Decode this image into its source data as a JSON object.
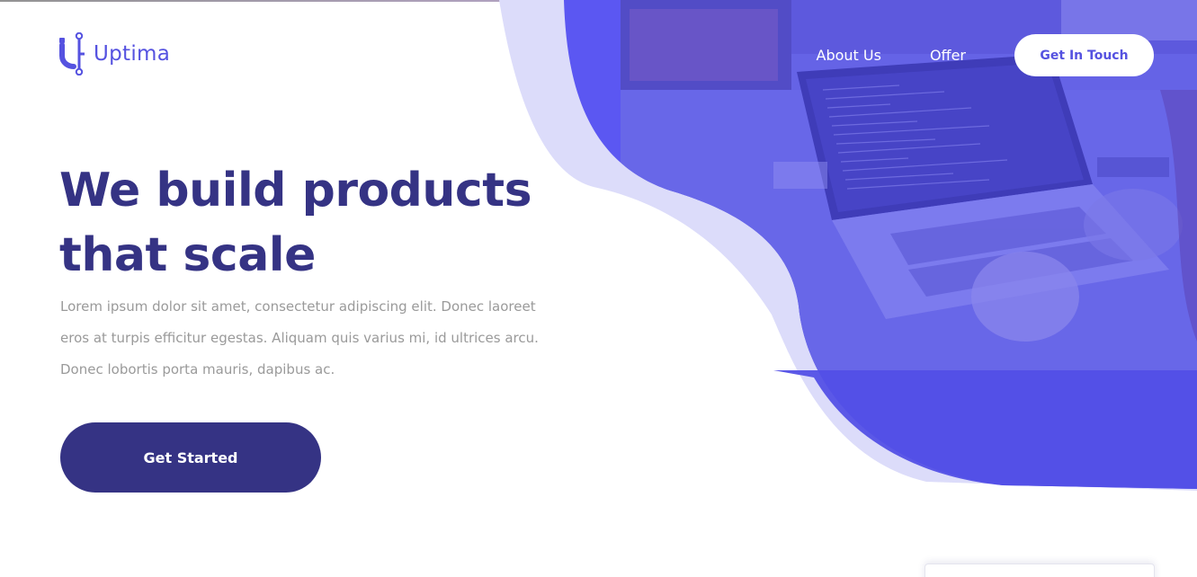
{
  "brand": {
    "name": "Uptima",
    "logo_icon": "uptima-logo-icon"
  },
  "nav": {
    "links": [
      "About Us",
      "Offer"
    ],
    "cta_label": "Get In Touch"
  },
  "hero": {
    "headline_line1": "We build products",
    "headline_line2": "that scale",
    "description": "Lorem ipsum dolor sit amet, consectetur adipiscing elit. Donec laoreet eros at turpis efficitur egestas. Aliquam quis varius mi, id ultrices arcu. Donec lobortis porta mauris, dapibus ac.",
    "cta_label": "Get Started",
    "image": "laptop-workspace-photo"
  },
  "colors": {
    "primary": "#5552e0",
    "dark": "#353384",
    "light_blob": "#dcdcfa",
    "text_muted": "#9a9a9a"
  }
}
